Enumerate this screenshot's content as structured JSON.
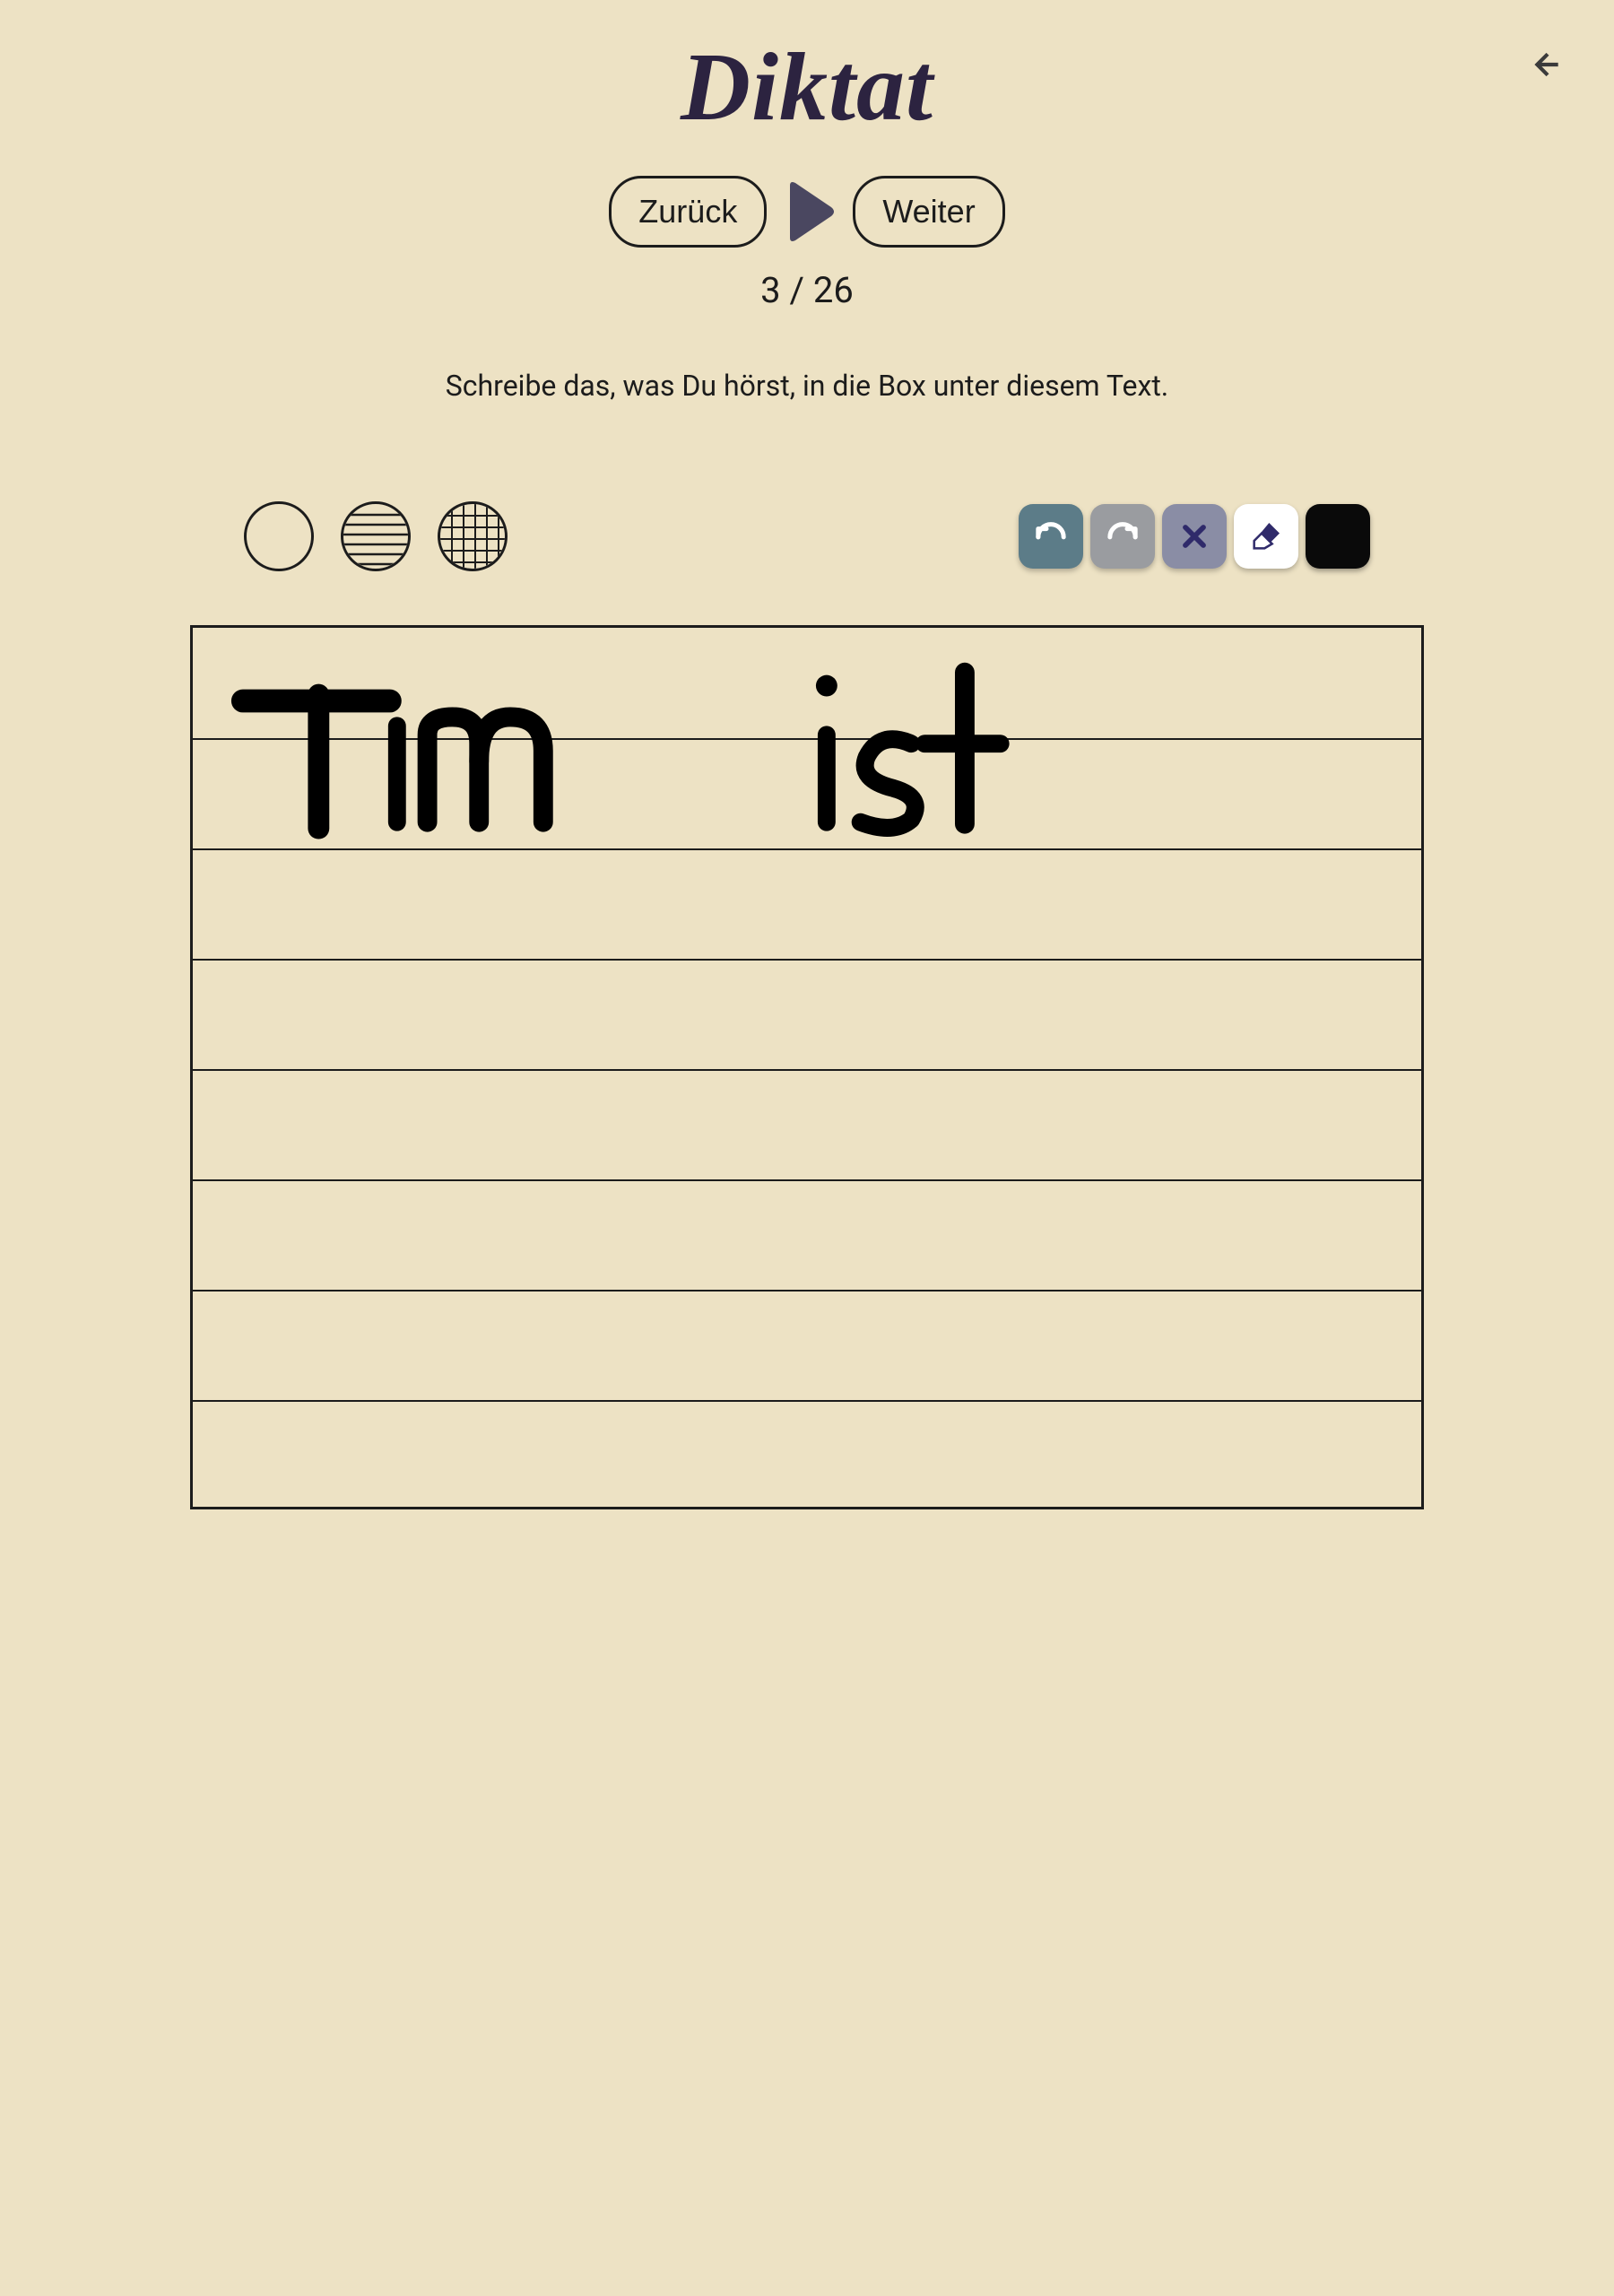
{
  "title": "Diktat",
  "nav": {
    "back_label": "Zurück",
    "next_label": "Weiter"
  },
  "progress": {
    "current": 3,
    "total": 26,
    "display": "3 / 26"
  },
  "instruction": "Schreibe das, was Du hörst, in die Box unter diesem Text.",
  "toolbar": {
    "background_options": [
      "blank",
      "lines",
      "grid"
    ],
    "selected_background": "lines",
    "pen_color": "#0a0a0a"
  },
  "colors": {
    "undo_bg": "#5c7c88",
    "redo_bg": "#9a9ca0",
    "clear_bg": "#8a8da5",
    "erase_bg": "#ffffff",
    "x_icon": "#2f2a6a",
    "eraser_icon": "#2f2a6a"
  },
  "canvas": {
    "line_count": 8,
    "handwritten_text": "Tim   ist"
  }
}
